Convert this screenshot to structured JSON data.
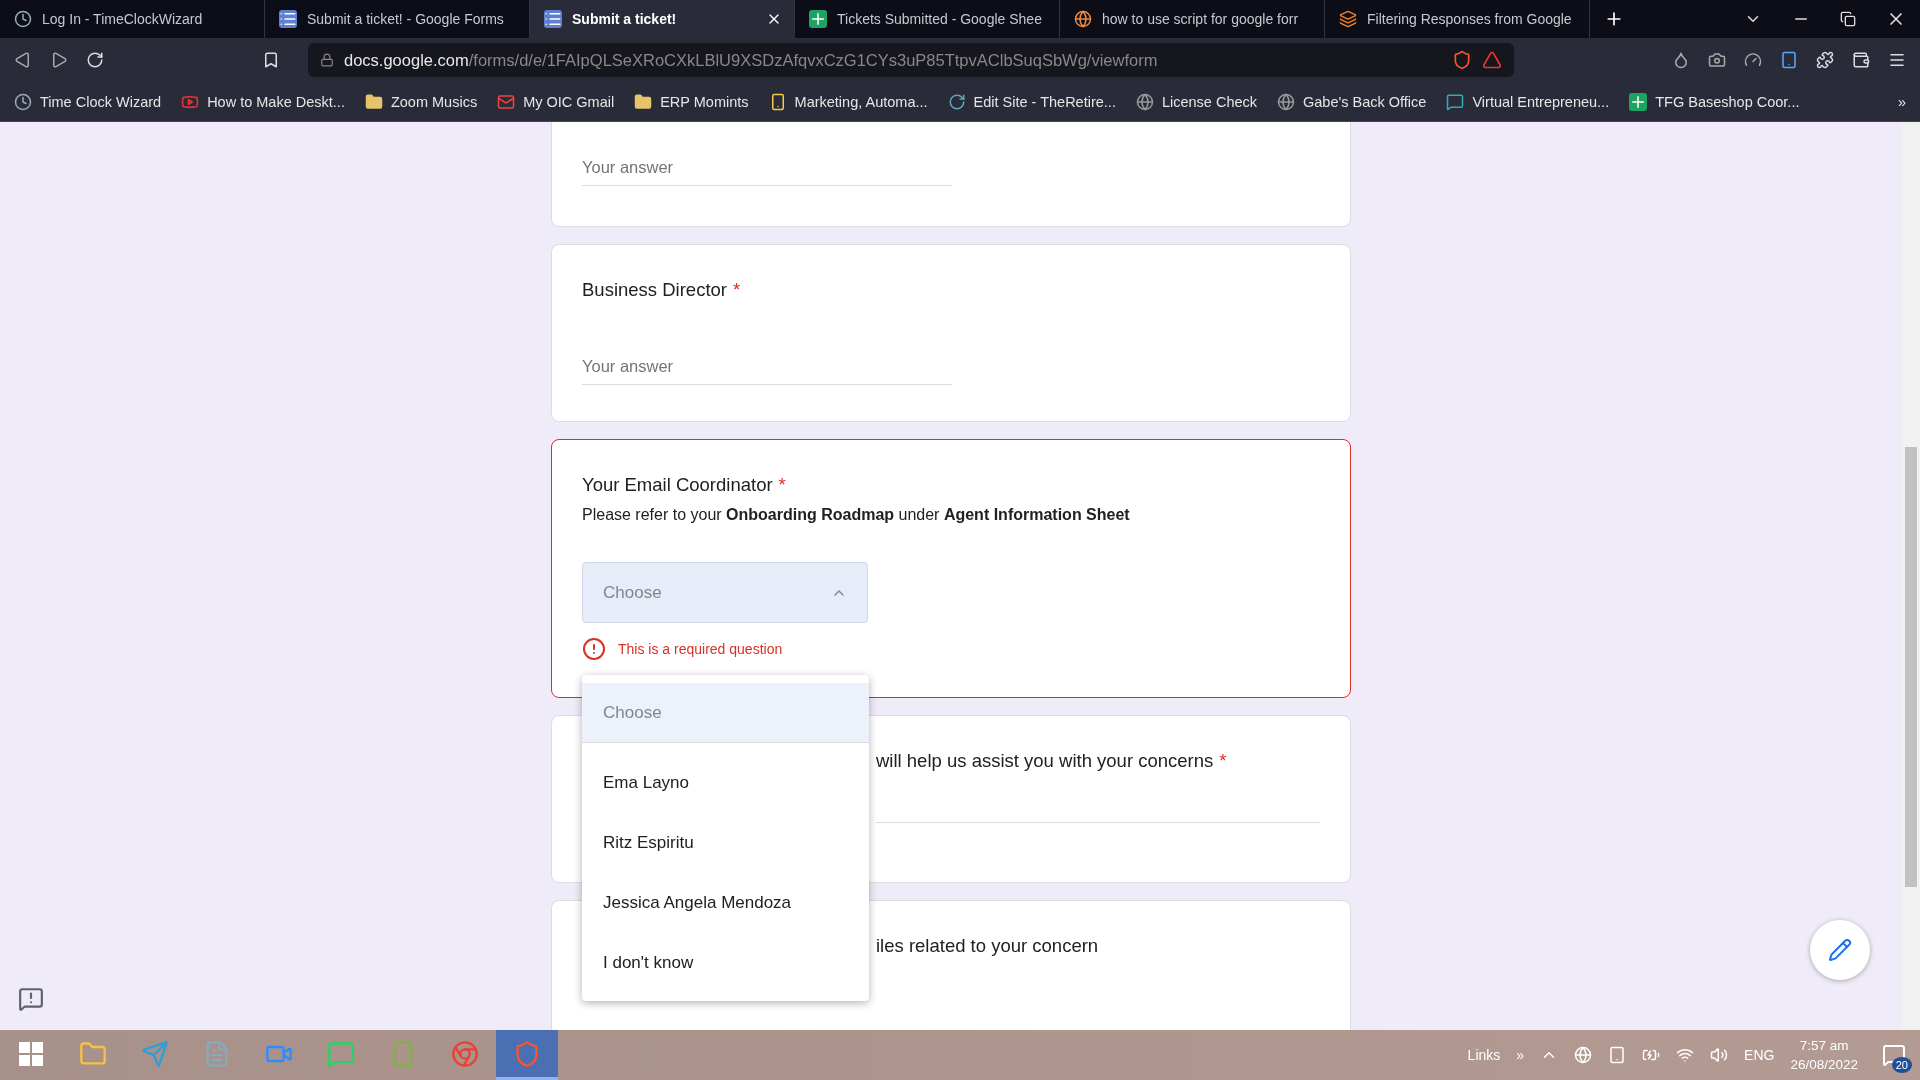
{
  "browser": {
    "tabs": [
      {
        "title": "Log In - TimeClockWizard",
        "selected": false
      },
      {
        "title": "Submit a ticket! - Google Forms",
        "selected": false
      },
      {
        "title": "Submit a ticket!",
        "selected": true
      },
      {
        "title": "Tickets Submitted - Google Shee",
        "selected": false
      },
      {
        "title": "how to use script for google forr",
        "selected": false
      },
      {
        "title": "Filtering Responses from Google",
        "selected": false
      }
    ],
    "address": {
      "domain": "docs.google.com",
      "path": "/forms/d/e/1FAIpQLSeXRoCXkLBlU9XSDzAfqvxCzG1CYs3uP85TtpvAClbSuqSbWg/viewform"
    },
    "bookmarks": [
      {
        "label": "Time Clock Wizard"
      },
      {
        "label": "How to Make Deskt..."
      },
      {
        "label": "Zoom Musics"
      },
      {
        "label": "My OIC Gmail"
      },
      {
        "label": "ERP Momints"
      },
      {
        "label": "Marketing, Automa..."
      },
      {
        "label": "Edit Site - TheRetire..."
      },
      {
        "label": "License Check"
      },
      {
        "label": "Gabe's Back Office"
      },
      {
        "label": "Virtual Entrepreneu..."
      },
      {
        "label": "TFG Baseshop Coor..."
      }
    ],
    "bookmarks_more": "»"
  },
  "form": {
    "cards": [
      {
        "kind": "text",
        "placeholder": "Your answer"
      },
      {
        "kind": "text",
        "title": "Business Director",
        "required_mark": "*",
        "placeholder": "Your answer"
      },
      {
        "kind": "dropdown",
        "title": "Your Email Coordinator",
        "required_mark": "*",
        "description": "Please refer to your **Onboarding Roadmap** under **Agent Information Sheet**",
        "value": "Choose",
        "expanded": true,
        "error": "This is a required question",
        "options": [
          {
            "label": "Choose",
            "selected": true
          },
          {
            "label": "Ema Layno",
            "selected": false
          },
          {
            "label": "Ritz Espiritu",
            "selected": false
          },
          {
            "label": "Jessica Angela Mendoza",
            "selected": false
          },
          {
            "label": "I don't know",
            "selected": false
          }
        ]
      },
      {
        "kind": "covered-text",
        "title": "will help us assist you with your concerns",
        "required_mark": "*"
      },
      {
        "kind": "covered-upload",
        "title": "iles related to your concern"
      }
    ]
  },
  "taskbar": {
    "apps": [
      {
        "selected": false
      },
      {
        "selected": false
      },
      {
        "selected": false
      },
      {
        "selected": false
      },
      {
        "selected": false
      },
      {
        "selected": false
      },
      {
        "selected": false
      },
      {
        "selected": true
      }
    ],
    "links": "Links",
    "links_more": "»",
    "language": "ENG",
    "time": "7:57 am",
    "date": "26/08/2022",
    "notifications": "20"
  }
}
